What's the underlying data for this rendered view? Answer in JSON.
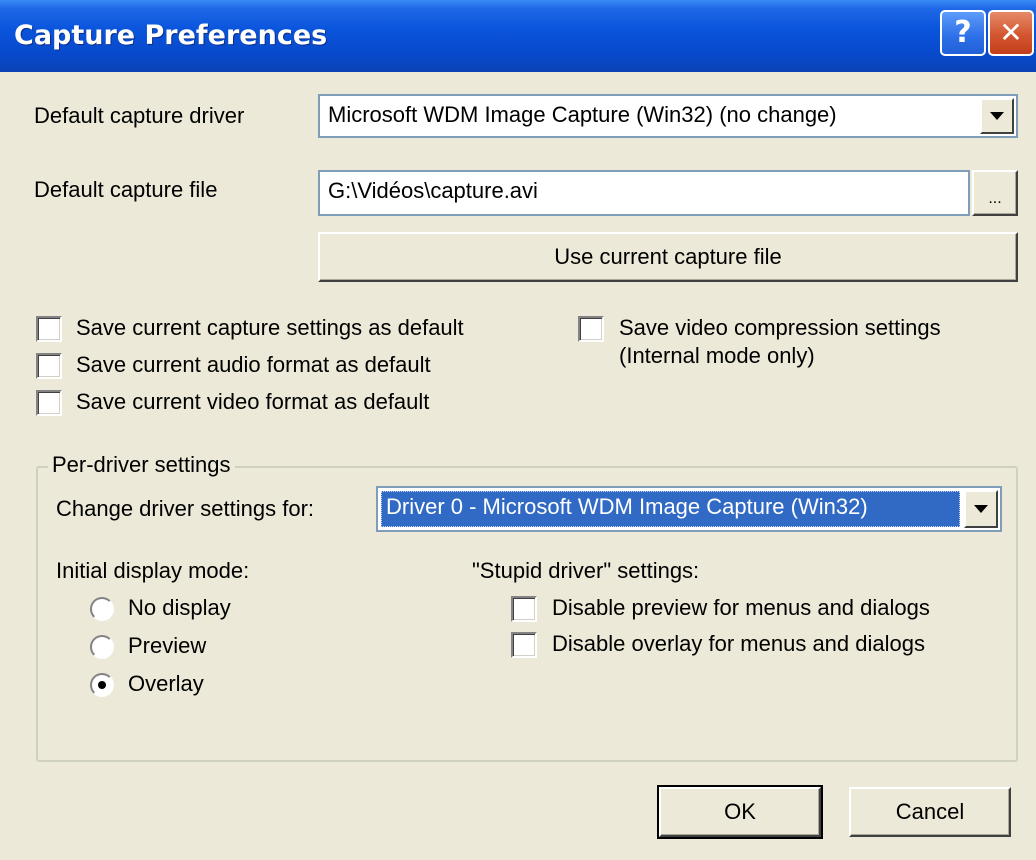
{
  "window": {
    "title": "Capture Preferences",
    "help_symbol": "?",
    "close_symbol": "✕"
  },
  "capture_driver": {
    "label": "Default capture driver",
    "selected": "Microsoft WDM Image Capture (Win32) (no change)"
  },
  "capture_file": {
    "label": "Default capture file",
    "value": "G:\\Vidéos\\capture.avi",
    "browse_label": "...",
    "use_current_label": "Use current capture file"
  },
  "save_options": [
    {
      "label": "Save current capture settings as default",
      "checked": false
    },
    {
      "label": "Save current audio format as default",
      "checked": false
    },
    {
      "label": "Save current video format as default",
      "checked": false
    }
  ],
  "compression": {
    "label_line1": "Save video compression settings",
    "label_line2": "(Internal mode only)",
    "checked": false
  },
  "per_driver": {
    "group_title": "Per-driver settings",
    "change_label": "Change driver settings for:",
    "driver_selected": "Driver 0 - Microsoft WDM Image Capture (Win32)",
    "display_mode_label": "Initial display mode:",
    "display_modes": [
      {
        "label": "No display",
        "selected": false
      },
      {
        "label": "Preview",
        "selected": false
      },
      {
        "label": "Overlay",
        "selected": true
      }
    ],
    "stupid_label": "\"Stupid driver\" settings:",
    "stupid_options": [
      {
        "label": "Disable preview for menus and dialogs",
        "checked": false
      },
      {
        "label": "Disable overlay for menus and dialogs",
        "checked": false
      }
    ]
  },
  "buttons": {
    "ok": "OK",
    "cancel": "Cancel"
  },
  "colors": {
    "titlebar": "#0A55DC",
    "dialog_bg": "#ECE9D8",
    "selection": "#316AC5"
  }
}
